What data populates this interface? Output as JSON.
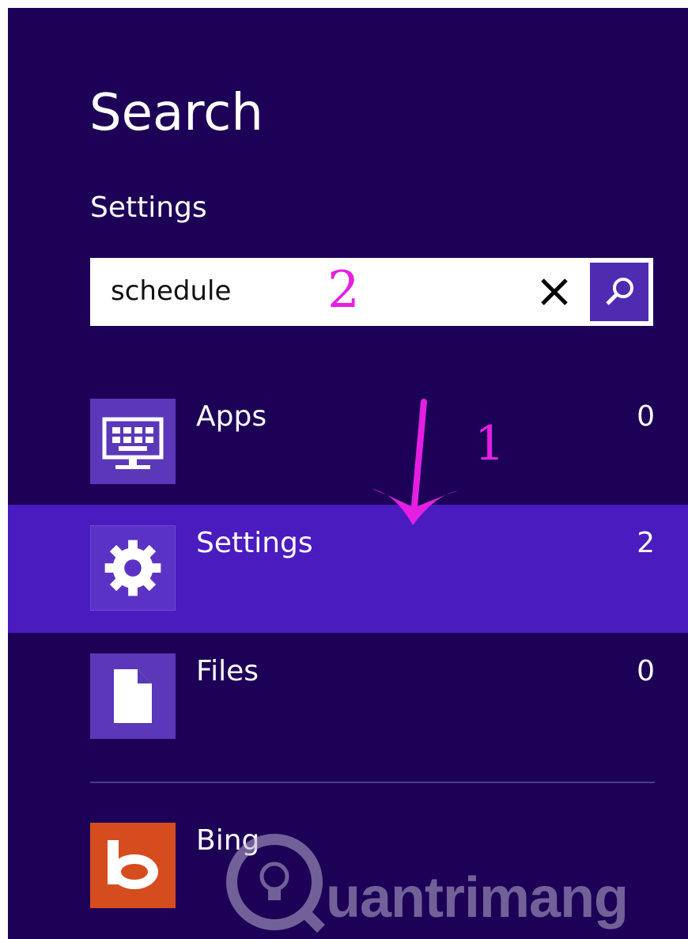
{
  "header": {
    "title": "Search",
    "scope": "Settings"
  },
  "search": {
    "value": "schedule"
  },
  "annotations": {
    "step_2": "2",
    "step_1": "1",
    "arrow_color": "#e41fe2"
  },
  "categories": [
    {
      "label": "Apps",
      "count": "0",
      "icon": "apps-monitor-icon",
      "selected": false
    },
    {
      "label": "Settings",
      "count": "2",
      "icon": "gear-icon",
      "selected": true
    },
    {
      "label": "Files",
      "count": "0",
      "icon": "file-icon",
      "selected": false
    }
  ],
  "web": {
    "label": "Bing",
    "icon": "bing-logo-icon"
  },
  "watermark": {
    "text": "uantrimang"
  },
  "colors": {
    "background": "#1d0157",
    "selected_row": "#4a1bbe",
    "tile": "#5b38b9",
    "bing": "#d54c1f"
  }
}
